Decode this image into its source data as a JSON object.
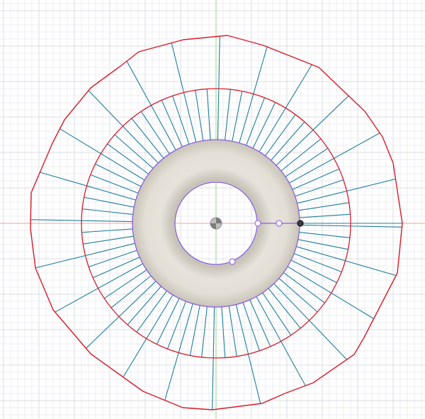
{
  "viewport": {
    "name": "sketch-canvas",
    "background_color": "#ffffff",
    "grid_minor_color": "#eceef2",
    "grid_major_color": "#d9dde3",
    "x_axis_color": "#f3a3a3",
    "y_axis_color": "#9bd68f"
  },
  "geometry": {
    "outer_profile_color": "#d81b2a",
    "middle_circle_color": "#d81b2a",
    "ray_color": "#1f7d9c",
    "ring_face_color": "#ddd9d0",
    "ring_edge_color": "#8b5fe0",
    "ray_count": 72,
    "handles": [
      {
        "name": "inner-edge-handle",
        "state": "inactive"
      },
      {
        "name": "mid-handle",
        "state": "inactive"
      },
      {
        "name": "outer-edge-handle",
        "state": "selected"
      },
      {
        "name": "bottom-handle",
        "state": "inactive"
      }
    ]
  }
}
